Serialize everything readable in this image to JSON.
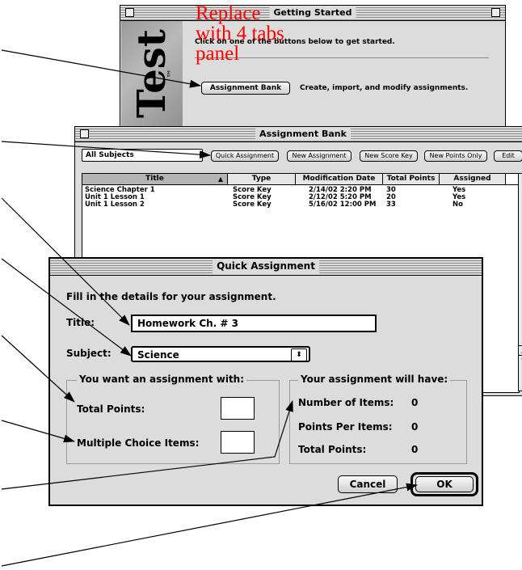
{
  "annotation": {
    "text": "Replace with 4 tabs panel",
    "color": "#ff0000"
  },
  "getting_started": {
    "title": "Getting Started",
    "instruction": "Click on one of the buttons below to get started.",
    "logo_text": "Test",
    "logo_tm": "™",
    "assignment_bank_button": "Assignment Bank",
    "assignment_bank_desc": "Create, import, and modify assignments."
  },
  "assignment_bank": {
    "title": "Assignment Bank",
    "subject_select": "All Subjects",
    "buttons": [
      "Quick Assignment",
      "New Assignment",
      "New Score Key",
      "New Points Only",
      "Edit"
    ],
    "columns": [
      "Title",
      "Type",
      "Modification Date",
      "Total Points",
      "Assigned"
    ],
    "rows": [
      [
        "Science Chapter 1",
        "Score Key",
        "2/14/02 2:20 PM",
        "30",
        "Yes"
      ],
      [
        "Unit 1 Lesson 1",
        "Score Key",
        "2/12/02 5:20 PM",
        "20",
        "Yes"
      ],
      [
        "Unit 1 Lesson 2",
        "Score Key",
        "5/16/02 12:00 PM",
        "33",
        "No"
      ]
    ]
  },
  "quick_assignment": {
    "title": "Quick Assignment",
    "intro": "Fill in the details for your assignment.",
    "title_label": "Title:",
    "title_value": "Homework Ch. # 3",
    "subject_label": "Subject:",
    "subject_value": "Science",
    "left_group": {
      "legend": "You want an assignment with:",
      "total_points_label": "Total Points:",
      "mc_items_label": "Multiple Choice Items:",
      "total_points_value": "",
      "mc_items_value": ""
    },
    "right_group": {
      "legend": "Your assignment will have:",
      "items": [
        {
          "label": "Number of Items:",
          "value": "0"
        },
        {
          "label": "Points Per Items:",
          "value": "0"
        },
        {
          "label": "Total Points:",
          "value": "0"
        }
      ]
    },
    "cancel_label": "Cancel",
    "ok_label": "OK"
  }
}
